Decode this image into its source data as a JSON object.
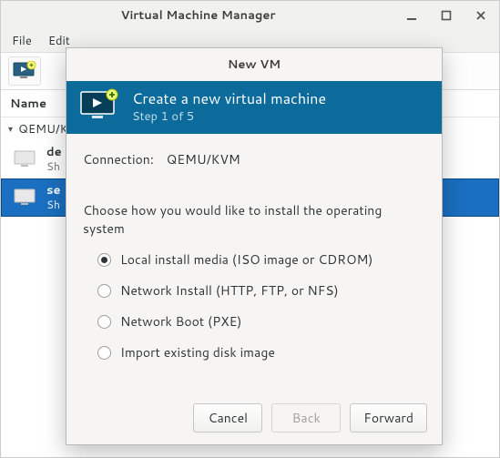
{
  "main_window": {
    "title": "Virtual Machine Manager",
    "menubar": {
      "file": "File",
      "edit": "Edit"
    },
    "list_header": "Name",
    "connection_row": "QEMU/KVM",
    "vm1": {
      "name_visible": "de",
      "state_visible": "Sh"
    },
    "vm2": {
      "name_visible": "se",
      "state_visible": "Sh"
    }
  },
  "dialog": {
    "title": "New VM",
    "header_title": "Create a new virtual machine",
    "header_step": "Step 1 of 5",
    "connection_label": "Connection:",
    "connection_value": "QEMU/KVM",
    "prompt": "Choose how you would like to install the operating system",
    "options": {
      "local": "Local install media (ISO image or CDROM)",
      "network": "Network Install (HTTP, FTP, or NFS)",
      "pxe": "Network Boot (PXE)",
      "import": "Import existing disk image"
    },
    "selected_option": "local",
    "buttons": {
      "cancel": "Cancel",
      "back": "Back",
      "forward": "Forward"
    }
  }
}
